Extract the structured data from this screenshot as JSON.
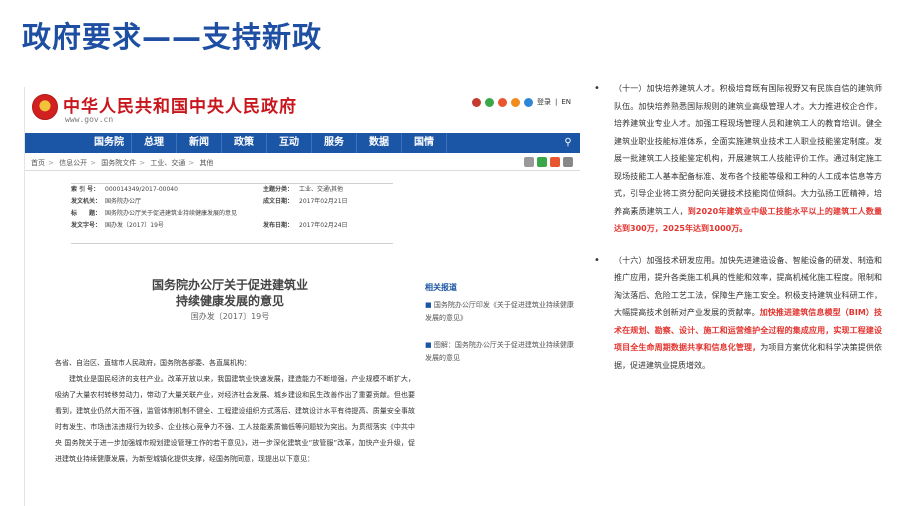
{
  "slide": {
    "title": "政府要求——支持新政"
  },
  "site": {
    "name": "中华人民共和国中央人民政府",
    "url": "www.gov.cn",
    "tools": [
      "登录",
      "EN"
    ]
  },
  "nav": [
    "国务院",
    "总理",
    "新闻",
    "政策",
    "互动",
    "服务",
    "数据",
    "国情"
  ],
  "breadcrumb": [
    "首页",
    "信息公开",
    "国务院文件",
    "工业、交通",
    "其他"
  ],
  "meta": {
    "rows": [
      {
        "k1": "索 引 号：",
        "v1": "000014349/2017-00040",
        "k2": "主题分类：",
        "v2": "工业、交通\\其他"
      },
      {
        "k1": "发文机关：",
        "v1": "国务院办公厅",
        "k2": "成文日期：",
        "v2": "2017年02月21日"
      },
      {
        "k1": "标　　题：",
        "v1": "国务院办公厅关于促进建筑业持续健康发展的意见",
        "k2": "",
        "v2": ""
      },
      {
        "k1": "发文字号：",
        "v1": "国办发〔2017〕19号",
        "k2": "发布日期：",
        "v2": "2017年02月24日"
      }
    ]
  },
  "doc": {
    "title_l1": "国务院办公厅关于促进建筑业",
    "title_l2": "持续健康发展的意见",
    "number": "国办发〔2017〕19号"
  },
  "related": {
    "heading": "相关报道",
    "items": [
      "国务院办公厅印发《关于促进建筑业持续健康发展的意见》",
      "图解：国务院办公厅关于促进建筑业持续健康发展的意见"
    ]
  },
  "body": {
    "p1": "各省、自治区、直辖市人民政府，国务院各部委、各直属机构：",
    "p2": "建筑业是国民经济的支柱产业。改革开放以来，我国建筑业快速发展，建造能力不断增强，产业规模不断扩大，吸纳了大量农村转移劳动力，带动了大量关联产业，对经济社会发展、城乡建设和民生改善作出了重要贡献。但也要看到，建筑业仍然大而不强，监管体制机制不健全、工程建设组织方式落后、建筑设计水平有待提高、质量安全事故时有发生、市场违法违规行为较多、企业核心竞争力不强、工人技能素质偏低等问题较为突出。为贯彻落实《中共中央 国务院关于进一步加强城市规划建设管理工作的若干意见》，进一步深化建筑业“放管服”改革，加快产业升级，促进建筑业持续健康发展，为新型城镇化提供支撑，经国务院同意，现提出以下意见："
  },
  "right": {
    "p1_a": "（十一）加快培养建筑人才。积极培育既有国际视野又有民族自信的建筑师队伍。加快培养熟悉国际规则的建筑业高级管理人才。大力推进校企合作，培养建筑业专业人才。加强工程现场管理人员和建筑工人的教育培训。健全建筑业职业技能标准体系，全面实施建筑业技术工人职业技能鉴定制度。发展一批建筑工人技能鉴定机构，开展建筑工人技能评价工作。通过制定施工现场技能工人基本配备标准、发布各个技能等级和工种的人工成本信息等方式，引导企业将工资分配向关键技术技能岗位倾斜。大力弘扬工匠精神，培养高素质建筑工人，",
    "p1_red": "到2020年建筑业中级工技能水平以上的建筑工人数量达到300万，2025年达到1000万。",
    "p2_a": "（十六）加强技术研发应用。加快先进建造设备、智能设备的研发、制造和推广应用，提升各类施工机具的性能和效率，提高机械化施工程度。限制和淘汰落后、危险工艺工法，保障生产施工安全。积极支持建筑业科研工作，大幅提高技术创新对产业发展的贡献率。",
    "p2_red": "加快推进建筑信息模型（BIM）技术在规划、勘察、设计、施工和运营维护全过程的集成应用，实现工程建设项目全生命周期数据共享和信息化管理，",
    "p2_b": "为项目方案优化和科学决策提供依据，促进建筑业提质增效。"
  },
  "colors": {
    "title_blue": "#1e4fa3",
    "gov_red": "#c8161d",
    "nav_blue": "#1b55a5",
    "highlight_red": "#e3342f"
  }
}
